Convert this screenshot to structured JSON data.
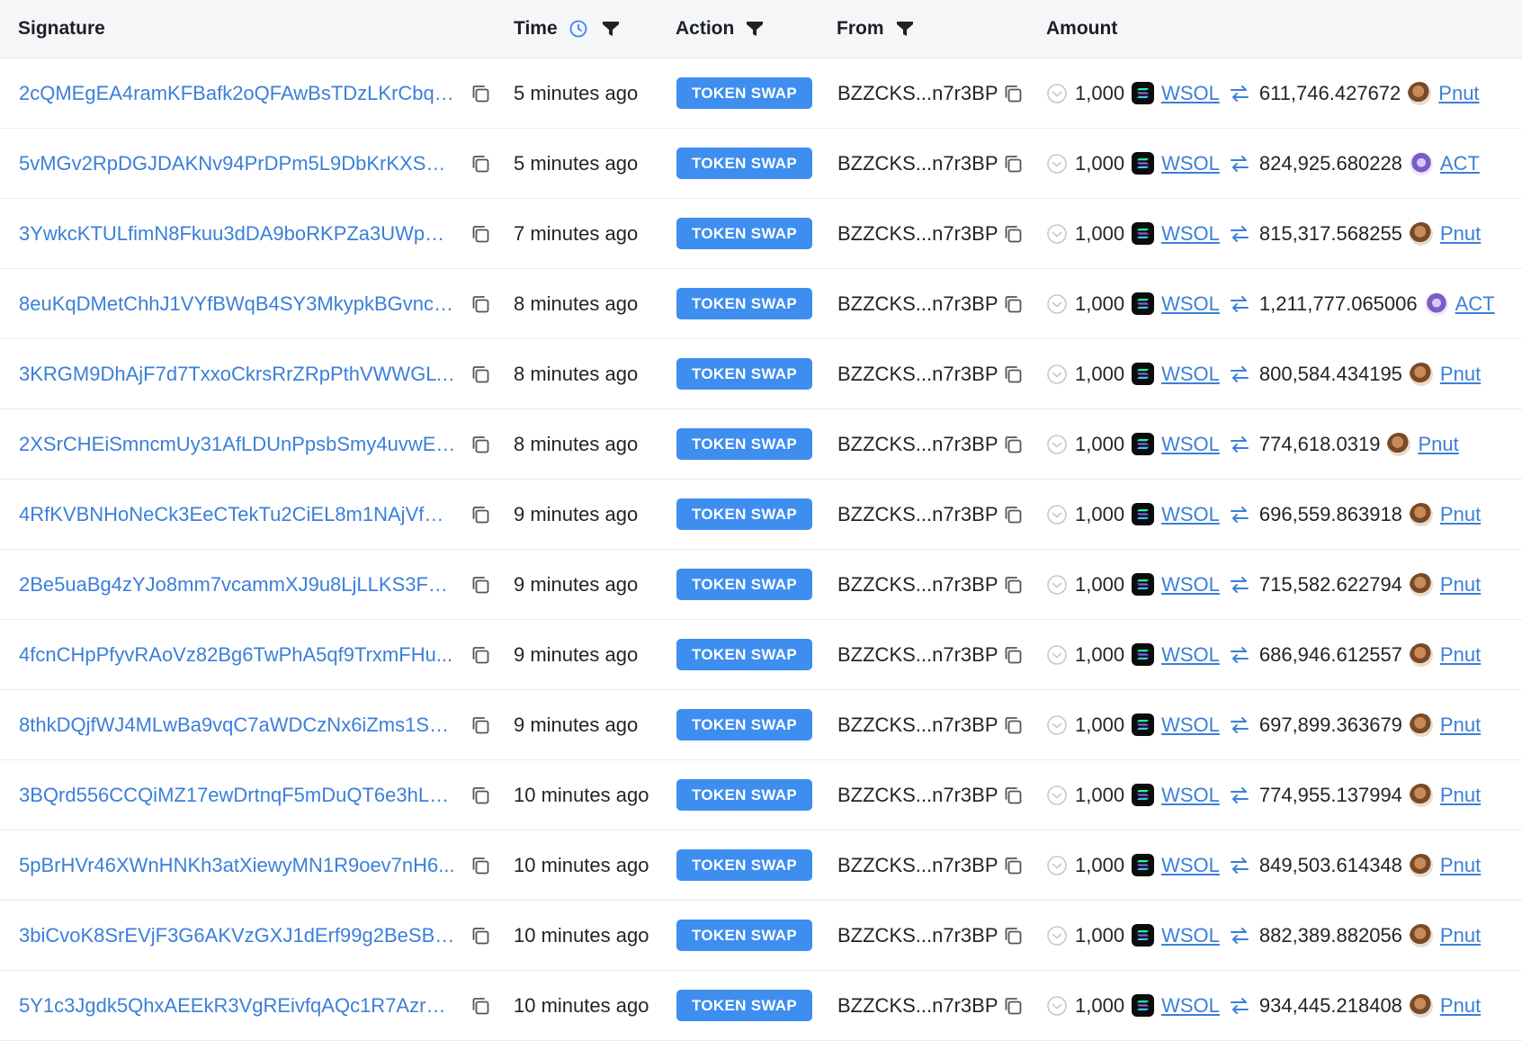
{
  "header": {
    "signature": "Signature",
    "time": "Time",
    "action": "Action",
    "from": "From",
    "amount": "Amount"
  },
  "rows": [
    {
      "signature": "2cQMEgEA4ramKFBafk2oQFAwBsTDzLKrCbq3...",
      "time": "5 minutes ago",
      "action": "TOKEN SWAP",
      "from": "BZZCKS...n7r3BP",
      "amount_in": "1,000",
      "token_in": "WSOL",
      "amount_out": "611,746.427672",
      "token_out": "Pnut"
    },
    {
      "signature": "5vMGv2RpDGJDAKNv94PrDPm5L9DbKrKXSXC...",
      "time": "5 minutes ago",
      "action": "TOKEN SWAP",
      "from": "BZZCKS...n7r3BP",
      "amount_in": "1,000",
      "token_in": "WSOL",
      "amount_out": "824,925.680228",
      "token_out": "ACT"
    },
    {
      "signature": "3YwkcKTULfimN8Fkuu3dDA9boRKPZa3UWpRi...",
      "time": "7 minutes ago",
      "action": "TOKEN SWAP",
      "from": "BZZCKS...n7r3BP",
      "amount_in": "1,000",
      "token_in": "WSOL",
      "amount_out": "815,317.568255",
      "token_out": "Pnut"
    },
    {
      "signature": "8euKqDMetChhJ1VYfBWqB4SY3MkypkBGvncx...",
      "time": "8 minutes ago",
      "action": "TOKEN SWAP",
      "from": "BZZCKS...n7r3BP",
      "amount_in": "1,000",
      "token_in": "WSOL",
      "amount_out": "1,211,777.065006",
      "token_out": "ACT"
    },
    {
      "signature": "3KRGM9DhAjF7d7TxxoCkrsRrZRpPthVWWGLT...",
      "time": "8 minutes ago",
      "action": "TOKEN SWAP",
      "from": "BZZCKS...n7r3BP",
      "amount_in": "1,000",
      "token_in": "WSOL",
      "amount_out": "800,584.434195",
      "token_out": "Pnut"
    },
    {
      "signature": "2XSrCHEiSmncmUy31AfLDUnPpsbSmy4uvwE7...",
      "time": "8 minutes ago",
      "action": "TOKEN SWAP",
      "from": "BZZCKS...n7r3BP",
      "amount_in": "1,000",
      "token_in": "WSOL",
      "amount_out": "774,618.0319",
      "token_out": "Pnut"
    },
    {
      "signature": "4RfKVBNHoNeCk3EeCTekTu2CiEL8m1NAjVfAa...",
      "time": "9 minutes ago",
      "action": "TOKEN SWAP",
      "from": "BZZCKS...n7r3BP",
      "amount_in": "1,000",
      "token_in": "WSOL",
      "amount_out": "696,559.863918",
      "token_out": "Pnut"
    },
    {
      "signature": "2Be5uaBg4zYJo8mm7vcammXJ9u8LjLLKS3FS...",
      "time": "9 minutes ago",
      "action": "TOKEN SWAP",
      "from": "BZZCKS...n7r3BP",
      "amount_in": "1,000",
      "token_in": "WSOL",
      "amount_out": "715,582.622794",
      "token_out": "Pnut"
    },
    {
      "signature": "4fcnCHpPfyvRAoVz82Bg6TwPhA5qf9TrxmFHu...",
      "time": "9 minutes ago",
      "action": "TOKEN SWAP",
      "from": "BZZCKS...n7r3BP",
      "amount_in": "1,000",
      "token_in": "WSOL",
      "amount_out": "686,946.612557",
      "token_out": "Pnut"
    },
    {
      "signature": "8thkDQjfWJ4MLwBa9vqC7aWDCzNx6iZms1SM...",
      "time": "9 minutes ago",
      "action": "TOKEN SWAP",
      "from": "BZZCKS...n7r3BP",
      "amount_in": "1,000",
      "token_in": "WSOL",
      "amount_out": "697,899.363679",
      "token_out": "Pnut"
    },
    {
      "signature": "3BQrd556CCQiMZ17ewDrtnqF5mDuQT6e3hLo...",
      "time": "10 minutes ago",
      "action": "TOKEN SWAP",
      "from": "BZZCKS...n7r3BP",
      "amount_in": "1,000",
      "token_in": "WSOL",
      "amount_out": "774,955.137994",
      "token_out": "Pnut"
    },
    {
      "signature": "5pBrHVr46XWnHNKh3atXiewyMN1R9oev7nH6...",
      "time": "10 minutes ago",
      "action": "TOKEN SWAP",
      "from": "BZZCKS...n7r3BP",
      "amount_in": "1,000",
      "token_in": "WSOL",
      "amount_out": "849,503.614348",
      "token_out": "Pnut"
    },
    {
      "signature": "3biCvoK8SrEVjF3G6AKVzGXJ1dErf99g2BeSBW...",
      "time": "10 minutes ago",
      "action": "TOKEN SWAP",
      "from": "BZZCKS...n7r3BP",
      "amount_in": "1,000",
      "token_in": "WSOL",
      "amount_out": "882,389.882056",
      "token_out": "Pnut"
    },
    {
      "signature": "5Y1c3Jgdk5QhxAEEkR3VgREivfqAQc1R7Azrux...",
      "time": "10 minutes ago",
      "action": "TOKEN SWAP",
      "from": "BZZCKS...n7r3BP",
      "amount_in": "1,000",
      "token_in": "WSOL",
      "amount_out": "934,445.218408",
      "token_out": "Pnut"
    }
  ],
  "icons": {
    "time_sort": "clock-icon",
    "filter": "filter-icon",
    "copy": "copy-icon",
    "status": "check-circle-icon",
    "token_in": "solana-logo-icon",
    "swap": "swap-arrows-icon",
    "token_out": "token-avatar-icon"
  },
  "colors": {
    "link": "#3b7fd9",
    "badge": "#3e8ef0",
    "header_bg": "#f5f6f8"
  }
}
